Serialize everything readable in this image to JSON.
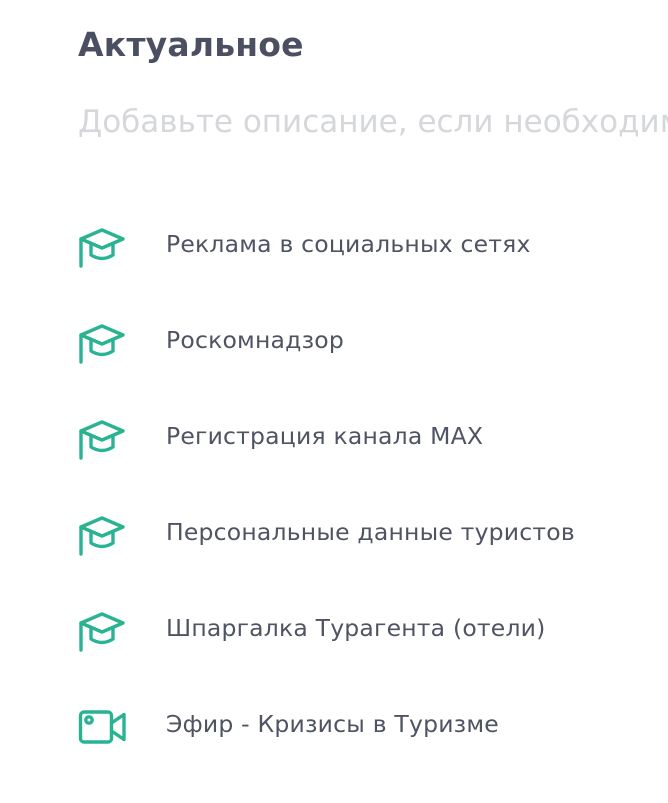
{
  "section": {
    "title": "Актуальное",
    "description_placeholder": "Добавьте описание, если необходимо"
  },
  "accent_color": "#29b393",
  "items": [
    {
      "label": "Реклама в социальных сетях",
      "icon": "graduation-cap-icon"
    },
    {
      "label": "Роскомнадзор",
      "icon": "graduation-cap-icon"
    },
    {
      "label": "Регистрация канала MAX",
      "icon": "graduation-cap-icon"
    },
    {
      "label": "Персональные данные туристов",
      "icon": "graduation-cap-icon"
    },
    {
      "label": "Шпаргалка Турагента (отели)",
      "icon": "graduation-cap-icon"
    },
    {
      "label": "Эфир - Кризисы в Туризме",
      "icon": "video-camera-icon"
    }
  ]
}
